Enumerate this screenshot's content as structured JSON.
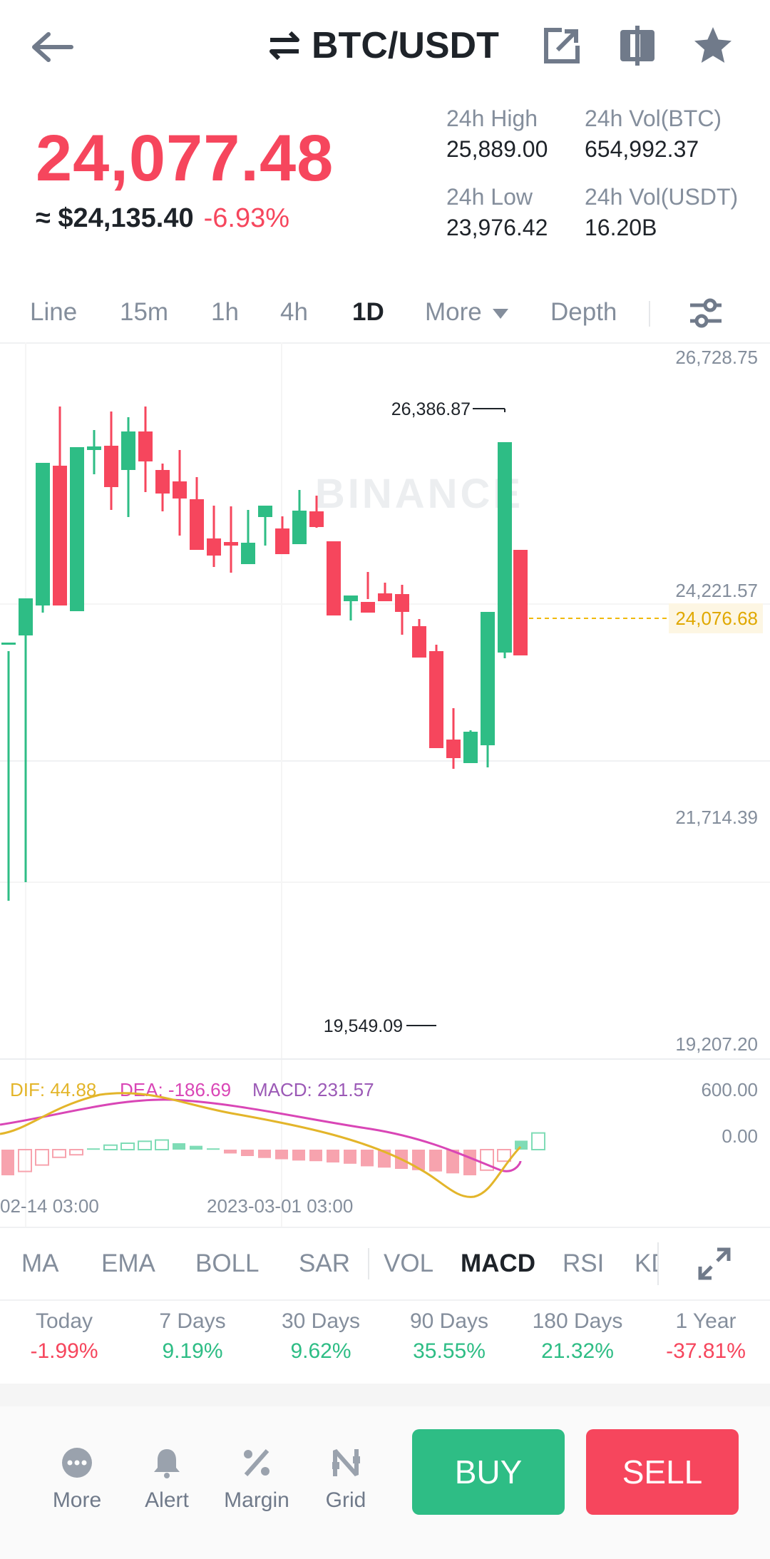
{
  "header": {
    "title": "BTC/USDT"
  },
  "price": {
    "last": "24,077.48",
    "fiat": "≈ $24,135.40",
    "change": "-6.93%"
  },
  "stats": {
    "high_label": "24h High",
    "high": "25,889.00",
    "vol_btc_label": "24h Vol(BTC)",
    "vol_btc": "654,992.37",
    "low_label": "24h Low",
    "low": "23,976.42",
    "vol_usdt_label": "24h Vol(USDT)",
    "vol_usdt": "16.20B"
  },
  "timeframes": [
    "Line",
    "15m",
    "1h",
    "4h",
    "1D",
    "More",
    "Depth"
  ],
  "chart": {
    "watermark": "BINANCE",
    "price_axis": [
      "26,728.75",
      "24,221.57",
      "21,714.39",
      "19,207.20"
    ],
    "current_price": "24,076.68",
    "high_marker": "26,386.87",
    "low_marker": "19,549.09",
    "macd": {
      "dif": "DIF: 44.88",
      "dea": "DEA: -186.69",
      "macd": "MACD: 231.57",
      "axis_top": "600.00",
      "axis_zero": "0.00"
    },
    "time_axis": [
      "02-14 03:00",
      "2023-03-01 03:00"
    ],
    "colors": {
      "up": "#2ebd85",
      "down": "#f6465d",
      "dif": "#e3b52a",
      "dea": "#d946b6",
      "macd": "#9b59b6"
    }
  },
  "indicators": [
    "MA",
    "EMA",
    "BOLL",
    "SAR",
    "VOL",
    "MACD",
    "RSI",
    "KDJ"
  ],
  "performance": [
    {
      "label": "Today",
      "value": "-1.99%"
    },
    {
      "label": "7 Days",
      "value": "9.19%"
    },
    {
      "label": "30 Days",
      "value": "9.62%"
    },
    {
      "label": "90 Days",
      "value": "35.55%"
    },
    {
      "label": "180 Days",
      "value": "21.32%"
    },
    {
      "label": "1 Year",
      "value": "-37.81%"
    }
  ],
  "bottom": {
    "more": "More",
    "alert": "Alert",
    "margin": "Margin",
    "grid": "Grid",
    "buy": "BUY",
    "sell": "SELL"
  }
}
